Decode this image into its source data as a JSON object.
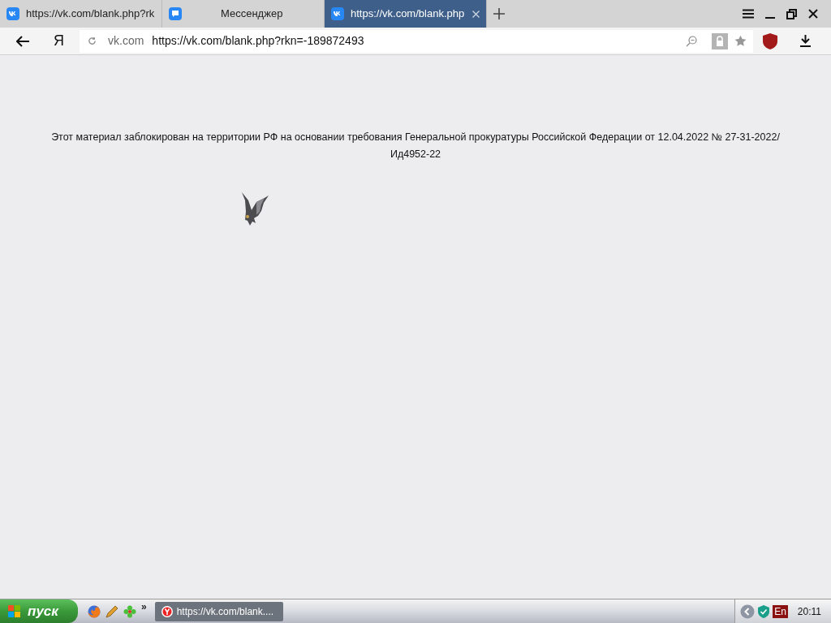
{
  "tabs": [
    {
      "kind": "vk",
      "title": "https://vk.com/blank.php?rk",
      "selected": false
    },
    {
      "kind": "messenger",
      "title": "Мессенджер",
      "selected": false
    },
    {
      "kind": "vk",
      "title": "https://vk.com/blank.php",
      "selected": true
    }
  ],
  "toolbar": {
    "search_logo": "Я",
    "address": {
      "domain": "vk.com",
      "url": "https://vk.com/blank.php?rkn=-189872493"
    }
  },
  "page": {
    "message": "Этот материал заблокирован на территории РФ на основании требования Генеральной прокуратуры Российской Федерации от 12.04.2022 № 27-31-2022/Ид4952-22"
  },
  "taskbar": {
    "start": "пуск",
    "more": "»",
    "tasks": [
      {
        "title": "https://vk.com/blank....",
        "selected": true
      }
    ],
    "tray": {
      "language": "En",
      "time": "20:11"
    }
  }
}
